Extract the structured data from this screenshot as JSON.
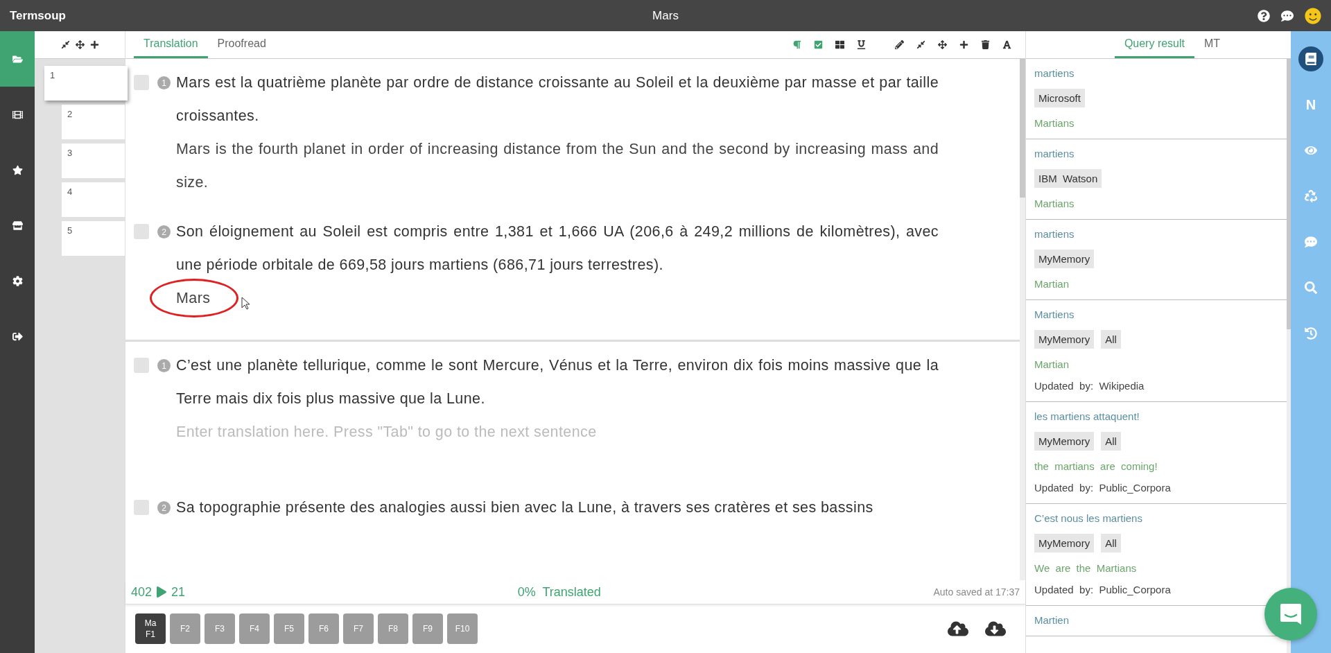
{
  "window": {
    "app_name": "Termsoup",
    "title": "Mars"
  },
  "nav": [
    {
      "kind": "folder",
      "selected": true
    },
    {
      "kind": "film",
      "selected": false
    },
    {
      "kind": "star",
      "selected": false
    },
    {
      "kind": "store",
      "selected": false
    },
    {
      "kind": "gear",
      "selected": false
    },
    {
      "kind": "exit",
      "selected": false
    }
  ],
  "pages": [
    {
      "label": "1",
      "selected": true
    },
    {
      "label": "2",
      "selected": false
    },
    {
      "label": "3",
      "selected": false
    },
    {
      "label": "4",
      "selected": false
    },
    {
      "label": "5",
      "selected": false
    }
  ],
  "editor_tabs": [
    {
      "label": "Translation",
      "selected": true
    },
    {
      "label": "Proofread",
      "selected": false
    }
  ],
  "format_toolbar": [
    {
      "kind": "paragraph"
    },
    {
      "kind": "check"
    },
    {
      "kind": "grid"
    },
    {
      "kind": "underline"
    }
  ],
  "edit_toolbar": [
    {
      "kind": "pencil"
    },
    {
      "kind": "compress"
    },
    {
      "kind": "move"
    },
    {
      "kind": "plus"
    },
    {
      "kind": "trash"
    },
    {
      "kind": "font"
    }
  ],
  "groups": [
    {
      "segments": [
        {
          "number": "1",
          "source": "Mars est la quatrième planète par ordre de distance croissante au Soleil et la deuxième par masse et par taille croissantes.",
          "target": "Mars is the fourth planet in order of increasing distance from the Sun and the second by increasing mass and size.",
          "checked": false
        },
        {
          "number": "2",
          "source": "Son éloignement au Soleil est compris entre 1,381 et 1,666 UA (206,6 à 249,2 millions de kilomètres), avec une période orbitale de 669,58 jours martiens (686,71 jours terrestres).",
          "target": "Mars",
          "annotated": true,
          "checked": false
        }
      ]
    },
    {
      "segments": [
        {
          "number": "1",
          "source": "C’est une planète tellurique, comme le sont Mercure, Vénus et la Terre, environ dix fois moins massive que la Terre mais dix fois plus massive que la Lune.",
          "placeholder": "Enter translation here. Press \"Tab\" to go to the next sentence",
          "checked": false
        },
        {
          "number": "2",
          "source": "Sa topographie présente des analogies aussi bien avec la Lune, à travers ses cratères et ses bassins",
          "checked": false
        }
      ]
    }
  ],
  "status": {
    "words": "402",
    "segments": "21",
    "progress": "0%  Translated",
    "saved": "Auto saved at 17:37"
  },
  "function_keys": [
    {
      "label": "F1",
      "sublabel": "Ma",
      "selected": true
    },
    {
      "label": "F2",
      "selected": false
    },
    {
      "label": "F3",
      "selected": false
    },
    {
      "label": "F4",
      "selected": false
    },
    {
      "label": "F5",
      "selected": false
    },
    {
      "label": "F6",
      "selected": false
    },
    {
      "label": "F7",
      "selected": false
    },
    {
      "label": "F8",
      "selected": false
    },
    {
      "label": "F9",
      "selected": false
    },
    {
      "label": "F10",
      "selected": false
    }
  ],
  "query_tabs": [
    {
      "label": "Query result",
      "selected": true
    },
    {
      "label": "MT",
      "selected": false
    }
  ],
  "results": [
    {
      "source": "martiens",
      "tags": [
        "Microsoft"
      ],
      "target": "Martians"
    },
    {
      "source": "martiens",
      "tags": [
        "IBM  Watson"
      ],
      "target": "Martians"
    },
    {
      "source": "martiens",
      "tags": [
        "MyMemory"
      ],
      "target": "Martian"
    },
    {
      "source": "Martiens",
      "tags": [
        "MyMemory",
        "All"
      ],
      "target": "Martian",
      "updated_by": "Updated  by:  Wikipedia"
    },
    {
      "source": "les  martiens  attaquent!",
      "tags": [
        "MyMemory",
        "All"
      ],
      "target": "the  martians  are  coming!",
      "updated_by": "Updated  by:  Public_Corpora"
    },
    {
      "source": "C’est  nous  les  martiens",
      "tags": [
        "MyMemory",
        "All"
      ],
      "target": "We  are  the  Martians",
      "updated_by": "Updated  by:  Public_Corpora"
    },
    {
      "source": "Martien"
    }
  ],
  "side_tools": [
    {
      "kind": "book",
      "selected": true
    },
    {
      "kind": "letter",
      "label": "N",
      "selected": false
    },
    {
      "kind": "eye",
      "selected": false
    },
    {
      "kind": "recycle",
      "selected": false
    },
    {
      "kind": "comment",
      "selected": false
    },
    {
      "kind": "search",
      "selected": false
    },
    {
      "kind": "history",
      "selected": false
    }
  ]
}
